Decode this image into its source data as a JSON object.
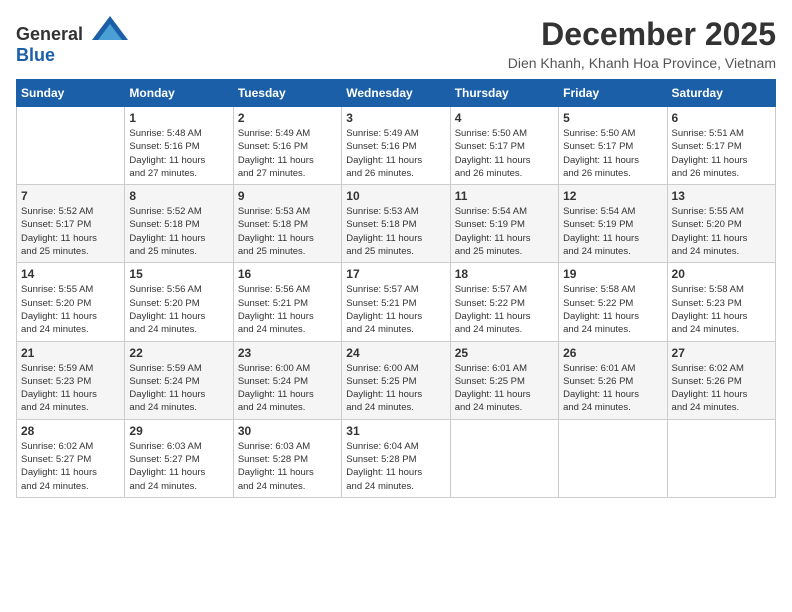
{
  "header": {
    "logo_general": "General",
    "logo_blue": "Blue",
    "month": "December 2025",
    "location": "Dien Khanh, Khanh Hoa Province, Vietnam"
  },
  "weekdays": [
    "Sunday",
    "Monday",
    "Tuesday",
    "Wednesday",
    "Thursday",
    "Friday",
    "Saturday"
  ],
  "weeks": [
    [
      {
        "day": "",
        "info": ""
      },
      {
        "day": "1",
        "info": "Sunrise: 5:48 AM\nSunset: 5:16 PM\nDaylight: 11 hours\nand 27 minutes."
      },
      {
        "day": "2",
        "info": "Sunrise: 5:49 AM\nSunset: 5:16 PM\nDaylight: 11 hours\nand 27 minutes."
      },
      {
        "day": "3",
        "info": "Sunrise: 5:49 AM\nSunset: 5:16 PM\nDaylight: 11 hours\nand 26 minutes."
      },
      {
        "day": "4",
        "info": "Sunrise: 5:50 AM\nSunset: 5:17 PM\nDaylight: 11 hours\nand 26 minutes."
      },
      {
        "day": "5",
        "info": "Sunrise: 5:50 AM\nSunset: 5:17 PM\nDaylight: 11 hours\nand 26 minutes."
      },
      {
        "day": "6",
        "info": "Sunrise: 5:51 AM\nSunset: 5:17 PM\nDaylight: 11 hours\nand 26 minutes."
      }
    ],
    [
      {
        "day": "7",
        "info": "Sunrise: 5:52 AM\nSunset: 5:17 PM\nDaylight: 11 hours\nand 25 minutes."
      },
      {
        "day": "8",
        "info": "Sunrise: 5:52 AM\nSunset: 5:18 PM\nDaylight: 11 hours\nand 25 minutes."
      },
      {
        "day": "9",
        "info": "Sunrise: 5:53 AM\nSunset: 5:18 PM\nDaylight: 11 hours\nand 25 minutes."
      },
      {
        "day": "10",
        "info": "Sunrise: 5:53 AM\nSunset: 5:18 PM\nDaylight: 11 hours\nand 25 minutes."
      },
      {
        "day": "11",
        "info": "Sunrise: 5:54 AM\nSunset: 5:19 PM\nDaylight: 11 hours\nand 25 minutes."
      },
      {
        "day": "12",
        "info": "Sunrise: 5:54 AM\nSunset: 5:19 PM\nDaylight: 11 hours\nand 24 minutes."
      },
      {
        "day": "13",
        "info": "Sunrise: 5:55 AM\nSunset: 5:20 PM\nDaylight: 11 hours\nand 24 minutes."
      }
    ],
    [
      {
        "day": "14",
        "info": "Sunrise: 5:55 AM\nSunset: 5:20 PM\nDaylight: 11 hours\nand 24 minutes."
      },
      {
        "day": "15",
        "info": "Sunrise: 5:56 AM\nSunset: 5:20 PM\nDaylight: 11 hours\nand 24 minutes."
      },
      {
        "day": "16",
        "info": "Sunrise: 5:56 AM\nSunset: 5:21 PM\nDaylight: 11 hours\nand 24 minutes."
      },
      {
        "day": "17",
        "info": "Sunrise: 5:57 AM\nSunset: 5:21 PM\nDaylight: 11 hours\nand 24 minutes."
      },
      {
        "day": "18",
        "info": "Sunrise: 5:57 AM\nSunset: 5:22 PM\nDaylight: 11 hours\nand 24 minutes."
      },
      {
        "day": "19",
        "info": "Sunrise: 5:58 AM\nSunset: 5:22 PM\nDaylight: 11 hours\nand 24 minutes."
      },
      {
        "day": "20",
        "info": "Sunrise: 5:58 AM\nSunset: 5:23 PM\nDaylight: 11 hours\nand 24 minutes."
      }
    ],
    [
      {
        "day": "21",
        "info": "Sunrise: 5:59 AM\nSunset: 5:23 PM\nDaylight: 11 hours\nand 24 minutes."
      },
      {
        "day": "22",
        "info": "Sunrise: 5:59 AM\nSunset: 5:24 PM\nDaylight: 11 hours\nand 24 minutes."
      },
      {
        "day": "23",
        "info": "Sunrise: 6:00 AM\nSunset: 5:24 PM\nDaylight: 11 hours\nand 24 minutes."
      },
      {
        "day": "24",
        "info": "Sunrise: 6:00 AM\nSunset: 5:25 PM\nDaylight: 11 hours\nand 24 minutes."
      },
      {
        "day": "25",
        "info": "Sunrise: 6:01 AM\nSunset: 5:25 PM\nDaylight: 11 hours\nand 24 minutes."
      },
      {
        "day": "26",
        "info": "Sunrise: 6:01 AM\nSunset: 5:26 PM\nDaylight: 11 hours\nand 24 minutes."
      },
      {
        "day": "27",
        "info": "Sunrise: 6:02 AM\nSunset: 5:26 PM\nDaylight: 11 hours\nand 24 minutes."
      }
    ],
    [
      {
        "day": "28",
        "info": "Sunrise: 6:02 AM\nSunset: 5:27 PM\nDaylight: 11 hours\nand 24 minutes."
      },
      {
        "day": "29",
        "info": "Sunrise: 6:03 AM\nSunset: 5:27 PM\nDaylight: 11 hours\nand 24 minutes."
      },
      {
        "day": "30",
        "info": "Sunrise: 6:03 AM\nSunset: 5:28 PM\nDaylight: 11 hours\nand 24 minutes."
      },
      {
        "day": "31",
        "info": "Sunrise: 6:04 AM\nSunset: 5:28 PM\nDaylight: 11 hours\nand 24 minutes."
      },
      {
        "day": "",
        "info": ""
      },
      {
        "day": "",
        "info": ""
      },
      {
        "day": "",
        "info": ""
      }
    ]
  ]
}
